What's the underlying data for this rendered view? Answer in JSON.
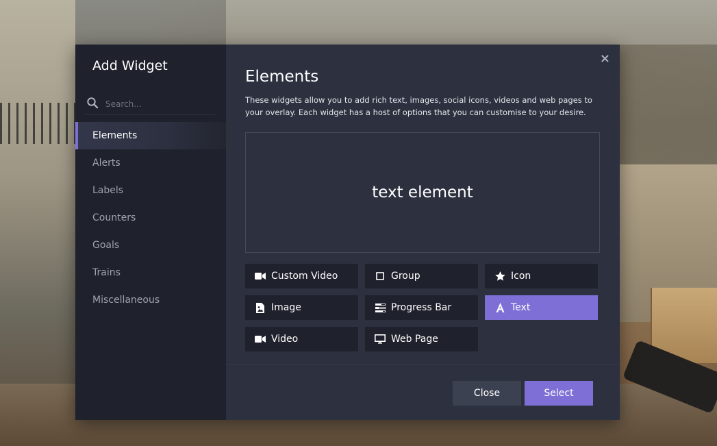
{
  "modal": {
    "title": "Add Widget",
    "close_glyph": "×"
  },
  "search": {
    "placeholder": "Search...",
    "value": ""
  },
  "sidebar": {
    "items": [
      {
        "label": "Elements",
        "active": true
      },
      {
        "label": "Alerts"
      },
      {
        "label": "Labels"
      },
      {
        "label": "Counters"
      },
      {
        "label": "Goals"
      },
      {
        "label": "Trains"
      },
      {
        "label": "Miscellaneous"
      }
    ]
  },
  "main": {
    "title": "Elements",
    "description": "These widgets allow you to add rich text, images, social icons, videos and web pages to your overlay. Each widget has a host of options that you can customise to your desire.",
    "preview_text": "text element"
  },
  "widgets": [
    {
      "label": "Custom Video",
      "icon": "video-camera-icon"
    },
    {
      "label": "Group",
      "icon": "square-outline-icon"
    },
    {
      "label": "Icon",
      "icon": "star-icon"
    },
    {
      "label": "Image",
      "icon": "image-file-icon"
    },
    {
      "label": "Progress Bar",
      "icon": "progress-bar-icon"
    },
    {
      "label": "Text",
      "icon": "text-a-icon",
      "selected": true
    },
    {
      "label": "Video",
      "icon": "video-camera-icon"
    },
    {
      "label": "Web Page",
      "icon": "monitor-icon"
    }
  ],
  "footer": {
    "close_label": "Close",
    "select_label": "Select"
  },
  "colors": {
    "accent": "#7e6fd6",
    "sidebar_bg": "#1f222c",
    "main_bg": "#2d313f"
  }
}
